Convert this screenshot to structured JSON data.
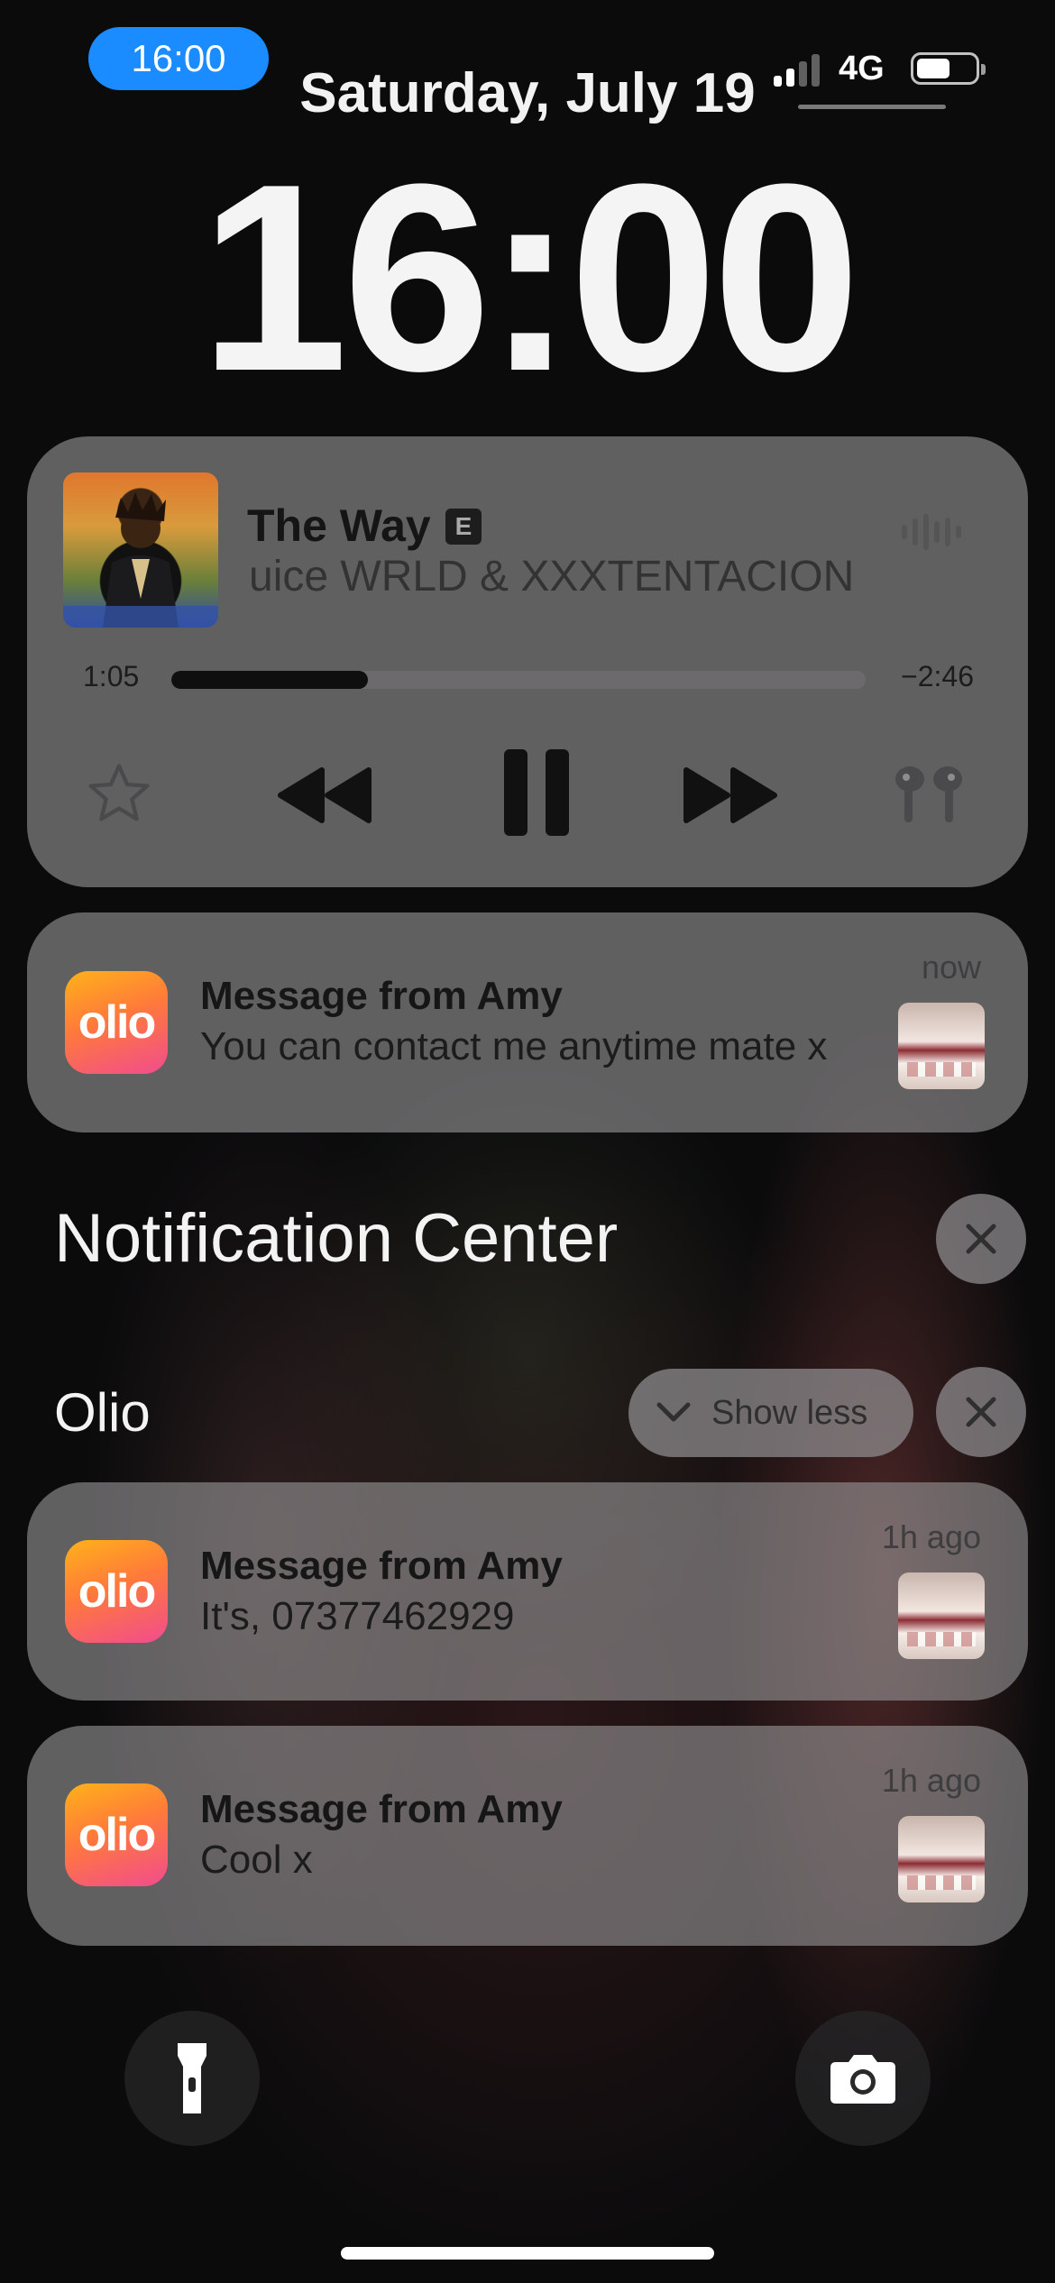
{
  "status_bar": {
    "time_pill": "16:00",
    "network": "4G",
    "signal_bars": 2,
    "battery_level": 0.55,
    "pill_color": "#1a8cff"
  },
  "lock_screen": {
    "date": "Saturday, July 19",
    "clock": "16:00"
  },
  "media_player": {
    "title": "The Way",
    "explicit_badge": "E",
    "artist": "Juice WRLD & XXXTENTACION",
    "elapsed": "1:05",
    "remaining": "−2:46",
    "progress": 0.283,
    "icons": [
      "audio-waveform-icon",
      "star-icon",
      "rewind-icon",
      "pause-icon",
      "fast-forward-icon",
      "airpods-icon"
    ]
  },
  "pinned_notification": {
    "app_icon_text": "olio",
    "title": "Message from Amy",
    "body": "You can contact me anytime mate x",
    "time": "now"
  },
  "notification_center": {
    "title": "Notification Center",
    "group": {
      "name": "Olio",
      "show_less_label": "Show less",
      "items": [
        {
          "app_icon_text": "olio",
          "title": "Message from Amy",
          "body": "It's, 07377462929",
          "time": "1h ago"
        },
        {
          "app_icon_text": "olio",
          "title": "Message from Amy",
          "body": "Cool x",
          "time": "1h ago"
        }
      ]
    }
  },
  "quick_actions": {
    "left": "flashlight-icon",
    "right": "camera-icon"
  },
  "colors": {
    "olio_gradient": [
      "#ffb21a",
      "#ff7a3a",
      "#f14c8e"
    ],
    "card_background": "rgba(150,148,150,0.62)"
  }
}
